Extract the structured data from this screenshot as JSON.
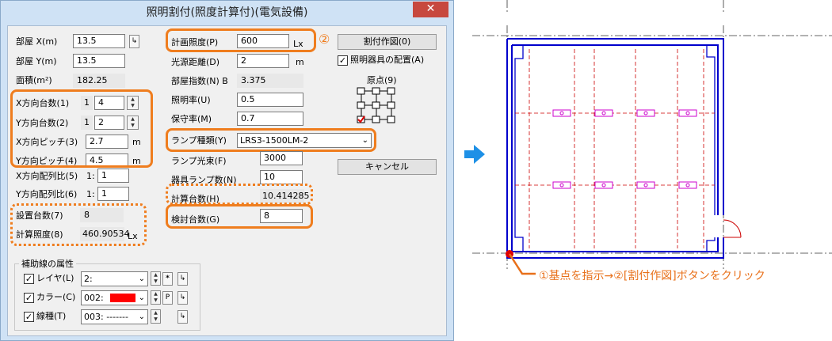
{
  "window": {
    "title": "照明割付(照度計算付)(電気設備)",
    "close_glyph": "✕"
  },
  "left": {
    "room_x": {
      "label": "部屋 X(m)",
      "value": "13.5"
    },
    "room_y": {
      "label": "部屋 Y(m)",
      "value": "13.5"
    },
    "area": {
      "label": "面積(m²)",
      "value": "182.25"
    },
    "x_count": {
      "label": "X方向台数(1)",
      "prefix": "1",
      "value": "4"
    },
    "y_count": {
      "label": "Y方向台数(2)",
      "prefix": "1",
      "value": "2"
    },
    "x_pitch": {
      "label": "X方向ピッチ(3)",
      "value": "2.7",
      "unit": "m"
    },
    "y_pitch": {
      "label": "Y方向ピッチ(4)",
      "value": "4.5",
      "unit": "m"
    },
    "x_ratio": {
      "label": "X方向配列比(5)",
      "prefix": "1:",
      "value": "1"
    },
    "y_ratio": {
      "label": "Y方向配列比(6)",
      "prefix": "1:",
      "value": "1"
    },
    "installed": {
      "label": "設置台数(7)",
      "value": "8"
    },
    "calc_lux": {
      "label": "計算照度(8)",
      "value": "460.90534",
      "unit": "Lx"
    }
  },
  "aux": {
    "title": "補助線の属性",
    "layer": {
      "label": "レイヤ(L)",
      "value": "2:",
      "extra": "*"
    },
    "color": {
      "label": "カラー(C)",
      "value": "002:",
      "extra": "P",
      "swatch": "#ff0000"
    },
    "linetype": {
      "label": "線種(T)",
      "value": "003: -------"
    }
  },
  "mid": {
    "design_lux": {
      "label": "計画照度(P)",
      "value": "600",
      "unit": "Lx"
    },
    "light_dist": {
      "label": "光源距離(D)",
      "value": "2",
      "unit": "m"
    },
    "room_index": {
      "label": "部屋指数(N) B",
      "value": "3.375"
    },
    "util_rate": {
      "label": "照明率(U)",
      "value": "0.5"
    },
    "maint_rate": {
      "label": "保守率(M)",
      "value": "0.7"
    },
    "lamp_type": {
      "label": "ランプ種類(Y)",
      "value": "LRS3-1500LM-2"
    },
    "lamp_flux": {
      "label": "ランプ光束(F)",
      "value": "3000"
    },
    "lamps_per": {
      "label": "器具ランプ数(N)",
      "value": "10"
    },
    "calc_count": {
      "label": "計算台数(H)",
      "value": "10.414285"
    },
    "check_count": {
      "label": "検討台数(G)",
      "value": "8"
    }
  },
  "right": {
    "layout_button": "割付作図(0)",
    "place_fixture": "照明器具の配置(A)",
    "origin_label": "原点(9)",
    "cancel_button": "キャンセル",
    "circle_two": "②"
  },
  "cad": {
    "instruction": "①基点を指示→②[割付作図]ボタンをクリック",
    "colors": {
      "wall": "#0000cc",
      "grid": "#cc0000",
      "fixture": "#cc00cc",
      "arrow": "#1e90e6",
      "callout": "#e8701a"
    }
  }
}
